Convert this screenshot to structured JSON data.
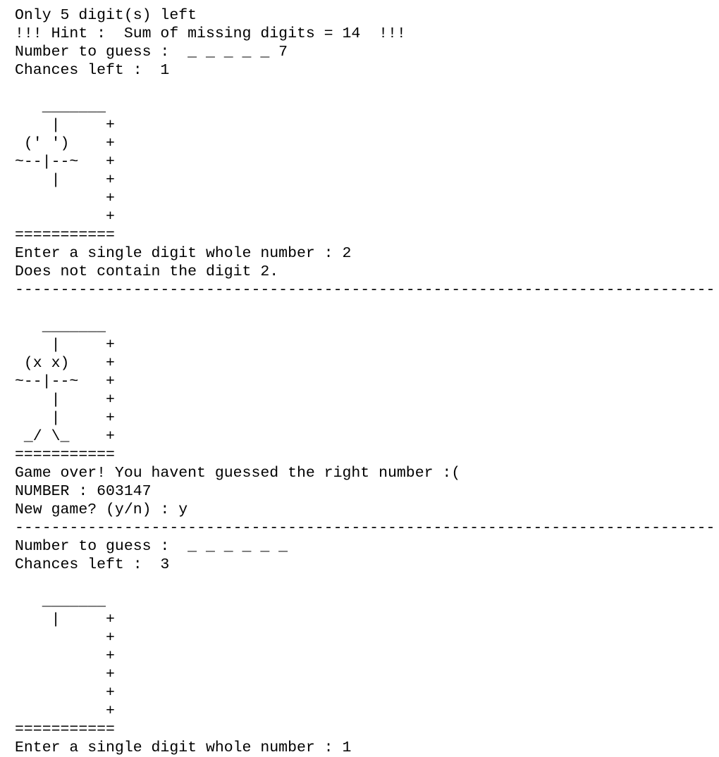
{
  "terminal": {
    "lines": [
      "-----------------------------------------------------------------------------",
      "Only 5 digit(s) left",
      "!!! Hint :  Sum of missing digits = 14  !!!",
      "Number to guess :  _ _ _ _ _ 7",
      "Chances left :  1",
      "",
      "   _______",
      "    |     +",
      " (' ')    +",
      "~--|--~   +",
      "    |     +",
      "          +",
      "          +",
      "===========",
      "Enter a single digit whole number : 2",
      "Does not contain the digit 2.",
      "-----------------------------------------------------------------------------",
      "",
      "   _______",
      "    |     +",
      " (x x)    +",
      "~--|--~   +",
      "    |     +",
      "    |     +",
      " _/ \\_    +",
      "===========",
      "Game over! You havent guessed the right number :(",
      "NUMBER : 603147",
      "New game? (y/n) : y",
      "-----------------------------------------------------------------------------",
      "Number to guess :  _ _ _ _ _ _",
      "Chances left :  3",
      "",
      "   _______",
      "    |     +",
      "          +",
      "          +",
      "          +",
      "          +",
      "          +",
      "===========",
      "Enter a single digit whole number : 1"
    ]
  }
}
